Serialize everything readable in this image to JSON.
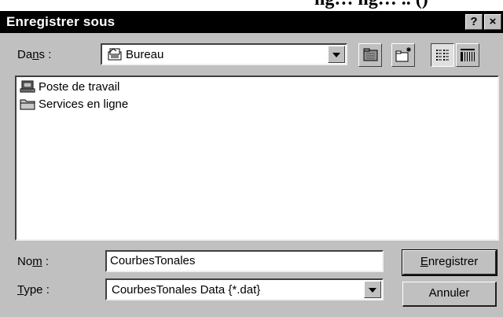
{
  "window": {
    "title": "Enregistrer sous",
    "help_glyph": "?",
    "close_glyph": "×"
  },
  "location": {
    "label_pre": "Da",
    "label_u": "n",
    "label_post": "s :",
    "value": "Bureau"
  },
  "files": [
    {
      "name": "Poste de travail",
      "icon": "computer-icon"
    },
    {
      "name": "Services en ligne",
      "icon": "folder-icon"
    }
  ],
  "filename": {
    "label_pre": "No",
    "label_u": "m",
    "label_post": " :",
    "value": "CourbesTonales"
  },
  "filetype": {
    "label_u": "T",
    "label_post": "ype :",
    "value": "CourbesTonales Data {*.dat}"
  },
  "buttons": {
    "save_u": "E",
    "save_rest": "nregistrer",
    "cancel": "Annuler"
  },
  "background_heading": "ng… ng… .. ()"
}
